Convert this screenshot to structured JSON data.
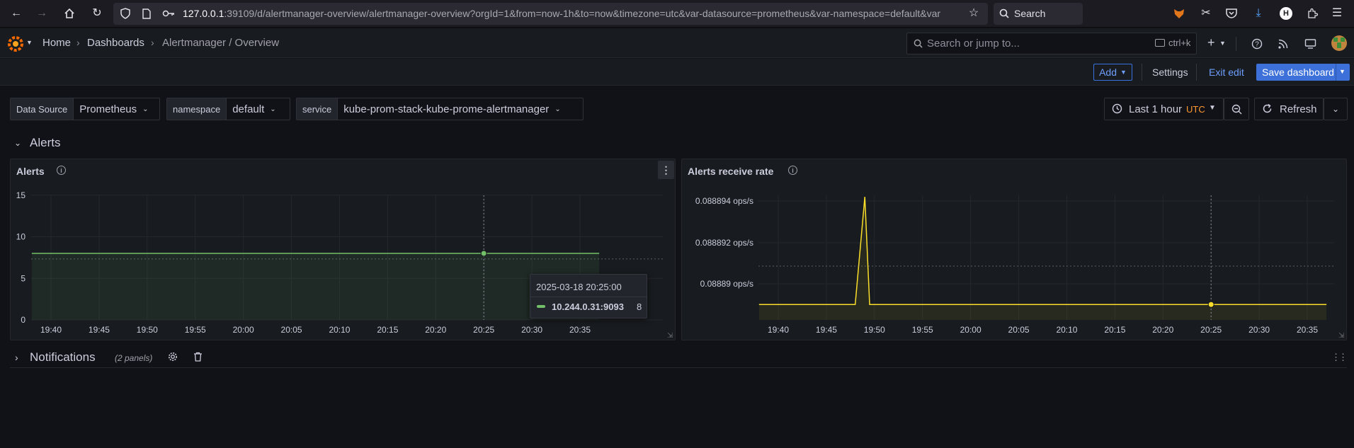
{
  "browser": {
    "url_host": "127.0.0.1",
    "url_rest": ":39109/d/alertmanager-overview/alertmanager-overview?orgId=1&from=now-1h&to=now&timezone=utc&var-datasource=prometheus&var-namespace=default&var",
    "search_label": "Search"
  },
  "nav": {
    "breadcrumbs": [
      "Home",
      "Dashboards",
      "Alertmanager / Overview"
    ],
    "search_placeholder": "Search or jump to...",
    "shortcut": "ctrl+k"
  },
  "toolbar": {
    "add_label": "Add",
    "settings_label": "Settings",
    "exit_edit_label": "Exit edit",
    "save_label": "Save dashboard"
  },
  "variables": [
    {
      "label": "Data Source",
      "value": "Prometheus"
    },
    {
      "label": "namespace",
      "value": "default"
    },
    {
      "label": "service",
      "value": "kube-prom-stack-kube-prome-alertmanager"
    }
  ],
  "time": {
    "range_label": "Last 1 hour",
    "timezone": "UTC",
    "refresh_label": "Refresh"
  },
  "rows": {
    "alerts_title": "Alerts",
    "notifications_title": "Notifications",
    "notifications_count": "(2 panels)"
  },
  "colors": {
    "green_series": "#73bf69",
    "yellow_series": "#fade2a",
    "accent_blue": "#3d71d9"
  },
  "chart_data": [
    {
      "type": "line",
      "title": "Alerts",
      "x_ticks": [
        "19:40",
        "19:45",
        "19:50",
        "19:55",
        "20:00",
        "20:05",
        "20:10",
        "20:15",
        "20:20",
        "20:25",
        "20:30",
        "20:35"
      ],
      "y_ticks": [
        "15",
        "10",
        "5",
        "0"
      ],
      "ylim": [
        0,
        16
      ],
      "series": [
        {
          "name": "10.244.0.31:9093",
          "points": [
            [
              "19:38",
              8
            ],
            [
              "20:37",
              8
            ]
          ]
        }
      ],
      "tooltip": {
        "time": "2025-03-18 20:25:00",
        "series": "10.244.0.31:9093",
        "value": "8"
      }
    },
    {
      "type": "line",
      "title": "Alerts receive rate",
      "x_ticks": [
        "19:40",
        "19:45",
        "19:50",
        "19:55",
        "20:00",
        "20:05",
        "20:10",
        "20:15",
        "20:20",
        "20:25",
        "20:30",
        "20:35"
      ],
      "y_ticks": [
        "0.088894 ops/s",
        "0.088892 ops/s",
        "0.08889 ops/s"
      ],
      "series": [
        {
          "name": "",
          "points": [
            [
              "19:38",
              0.088889
            ],
            [
              "19:48",
              0.088889
            ],
            [
              "19:49",
              0.0888942
            ],
            [
              "19:49.5",
              0.088889
            ],
            [
              "20:37",
              0.088889
            ]
          ]
        }
      ]
    }
  ]
}
